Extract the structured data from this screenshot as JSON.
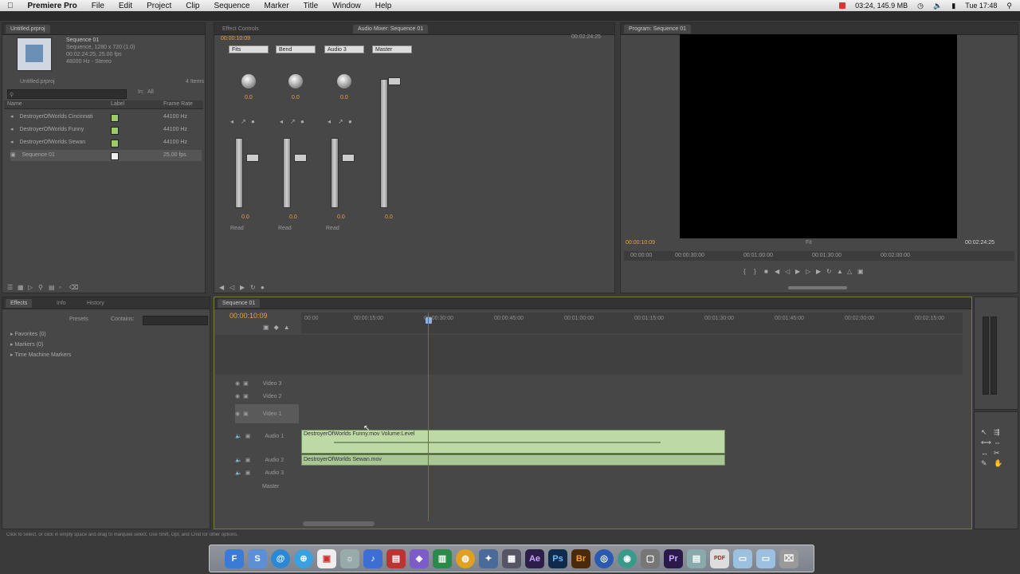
{
  "menubar": {
    "app_name": "Premiere Pro",
    "items": [
      "File",
      "Edit",
      "Project",
      "Clip",
      "Sequence",
      "Marker",
      "Title",
      "Window",
      "Help"
    ],
    "status": "03:24, 145.9 MB",
    "clock": "Tue 17:48"
  },
  "project_panel": {
    "clip_name": "Sequence 01",
    "clip_info": [
      "Sequence, 1280 x 720 (1.0)",
      "00:02:24:25, 25.00 fps",
      "48000 Hz - Stereo"
    ],
    "folder_label": "Untitled.prproj",
    "items_count": "4 Items",
    "in_label": "In:",
    "in_value": "All",
    "col_name": "Name",
    "col_label": "Label",
    "col_rate": "Frame Rate",
    "rows": [
      {
        "name": "DestroyerOfWorlds Cincinnati",
        "rate": "44100 Hz"
      },
      {
        "name": "DestroyerOfWorlds Funny",
        "rate": "44100 Hz"
      },
      {
        "name": "DestroyerOfWorlds Sewan",
        "rate": "44100 Hz"
      },
      {
        "name": "Sequence 01",
        "rate": "25.00 fps"
      }
    ]
  },
  "mixer_panel": {
    "tab": "Audio Mixer: Sequence 01",
    "tab2": "Effect Controls",
    "timecode": "00:00:10:09",
    "right_tc": "00:02:24:25",
    "channels": [
      "Fits",
      "Bend",
      "Audio 3",
      "Master"
    ],
    "modes": [
      "Read",
      "Read",
      "Read"
    ],
    "pan_values": [
      "0.0",
      "0.0",
      "0.0"
    ],
    "fader_values": [
      "0.0",
      "0.0",
      "0.0",
      "0.0"
    ]
  },
  "program_monitor": {
    "tab": "Program: Sequence 01",
    "current_tc": "00:00:10:09",
    "fit_label": "Fit",
    "duration_tc": "00:02:24:25",
    "ruler": [
      "00:00:00",
      "00:00:30:00",
      "00:01:00:00",
      "00:01:30:00",
      "00:02:00:00"
    ]
  },
  "effects_panel": {
    "tab": "Effects",
    "tab2": "Info",
    "tab3": "History",
    "presets_label": "Presets",
    "contains_label": "Contains:",
    "items": [
      "Favorites (0)",
      "Markers (0)",
      "Time Machine Markers"
    ]
  },
  "timeline": {
    "tab": "Sequence 01",
    "timecode": "00:00:10:09",
    "ruler": [
      "00:00",
      "00:00:15:00",
      "00:00:30:00",
      "00:00:45:00",
      "00:01:00:00",
      "00:01:15:00",
      "00:01:30:00",
      "00:01:45:00",
      "00:02:00:00",
      "00:02:15:00"
    ],
    "video_tracks": [
      "Video 3",
      "Video 2",
      "Video 1"
    ],
    "audio_tracks": [
      "Audio 1",
      "Audio 2",
      "Audio 3",
      "Master"
    ],
    "clip_audio1": "DestroyerOfWorlds Funny.mov Volume:Level",
    "clip_audio2": "DestroyerOfWorlds Sewan.mov"
  },
  "statusbar": "Click to select, or click in empty space and drag to marquee select. Use Shift, Opt, and Cmd for other options.",
  "dock": [
    "F",
    "S",
    "@",
    "⊕",
    "▣",
    "☼",
    "♪",
    "▤",
    "◈",
    "▥",
    "◍",
    "✦",
    "▦",
    "Ae",
    "Ps",
    "Br",
    "◎",
    "◉",
    "▢",
    "Pr",
    "▤",
    "PDF",
    "▭",
    "▭",
    "⌧"
  ]
}
